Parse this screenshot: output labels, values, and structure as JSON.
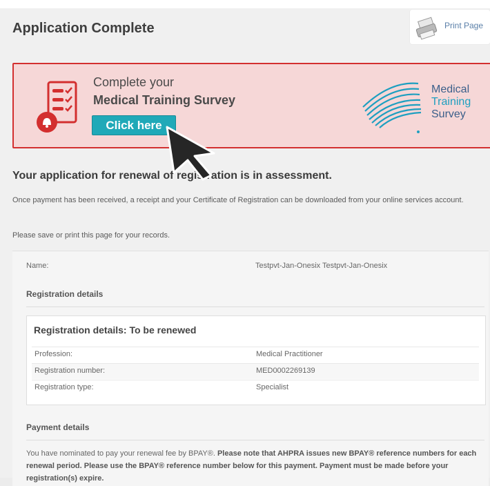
{
  "header": {
    "title": "Application Complete",
    "print_label": "Print Page"
  },
  "survey_banner": {
    "line1": "Complete your",
    "line2": "Medical Training Survey",
    "cta": "Click here",
    "logo_line1": "Medical",
    "logo_line2": "Training",
    "logo_line3": "Survey",
    "colors": {
      "border": "#d32f2f",
      "background": "#f6d7d7",
      "cta": "#20a9b8"
    }
  },
  "status": {
    "heading": "Your application for renewal of registration is in assessment.",
    "paragraph1": "Once payment has been received, a receipt and your Certificate of Registration can be downloaded from your online services account.",
    "paragraph2": "Please save or print this page for your records."
  },
  "details": {
    "name_label": "Name:",
    "name_value": "Testpvt-Jan-Onesix Testpvt-Jan-Onesix",
    "registration_section": "Registration details",
    "registration_box_title": "Registration details: To be renewed",
    "rows": [
      {
        "label": "Profession:",
        "value": "Medical Practitioner"
      },
      {
        "label": "Registration number:",
        "value": "MED0002269139"
      },
      {
        "label": "Registration type:",
        "value": "Specialist"
      }
    ]
  },
  "payment": {
    "section": "Payment details",
    "text_normal": "You have nominated to pay your renewal fee by BPAY®. ",
    "text_bold": "Please note that AHPRA issues new BPAY® reference numbers for each renewal period. Please use the BPAY® reference number below for this payment. Payment must be made before your registration(s) expire."
  }
}
